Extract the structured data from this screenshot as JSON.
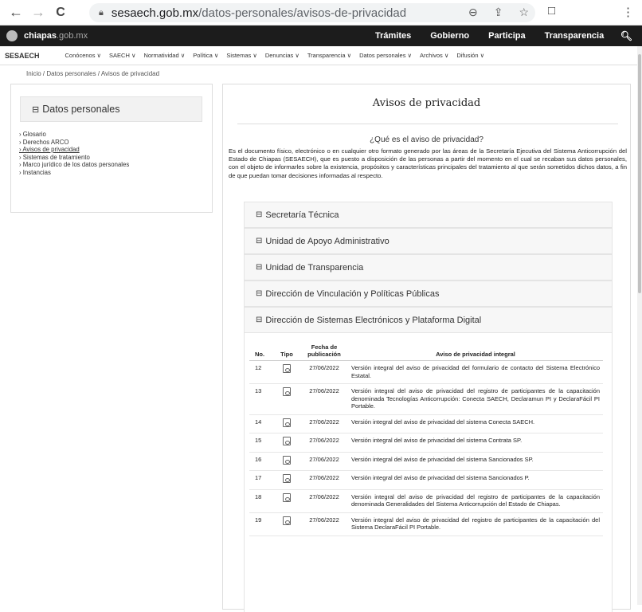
{
  "browser": {
    "back": "←",
    "forward": "→",
    "reload": "C",
    "url_host": "sesaech.gob.mx",
    "url_path": "/datos-personales/avisos-de-privacidad"
  },
  "topbar": {
    "logo_bold": "chiapas",
    "logo_rest": ".gob.mx",
    "links": [
      "Trámites",
      "Gobierno",
      "Participa",
      "Transparencia"
    ]
  },
  "subnav": {
    "brand": "SESAECH",
    "items": [
      "Conócenos ∨",
      "SAECH ∨",
      "Normatividad ∨",
      "Política ∨",
      "Sistemas ∨",
      "Denuncias ∨",
      "Transparencia ∨",
      "Datos personales ∨",
      "Archivos ∨",
      "Difusión ∨"
    ]
  },
  "breadcrumb": "Inicio / Datos personales / Avisos de privacidad",
  "side": {
    "title": "Datos personales",
    "items": [
      "› Glosario",
      "› Derechos ARCO",
      "› Avisos de privacidad",
      "› Sistemas de tratamiento",
      "› Marco jurídico de los datos personales",
      "› Instancias"
    ]
  },
  "main": {
    "title": "Avisos de privacidad",
    "question": "¿Qué es el aviso de privacidad?",
    "intro": "Es el documento físico, electrónico o en cualquier otro formato generado por las áreas de la Secretaría Ejecutiva del Sistema Anticorrupción del Estado de Chiapas (SESAECH), que es puesto a disposición de las personas a partir del momento en el cual se recaban sus datos personales, con el objeto de informarles sobre la existencia, propósitos y características principales del tratamiento al que serán sometidos dichos datos, a fin de que puedan tomar decisiones informadas al respecto.",
    "sections": [
      "Secretaría Técnica",
      "Unidad de Apoyo Administrativo",
      "Unidad de Transparencia",
      "Dirección de Vinculación y Políticas Públicas",
      "Dirección de Sistemas Electrónicos y Plataforma Digital"
    ],
    "table": {
      "headers": [
        "No.",
        "Tipo",
        "Fecha de publicación",
        "Aviso de privacidad integral"
      ],
      "rows": [
        {
          "no": "12",
          "fecha": "27/06/2022",
          "desc": "Versión integral del aviso de privacidad del formulario de contacto del Sistema Electrónico Estatal."
        },
        {
          "no": "13",
          "fecha": "27/06/2022",
          "desc": "Versión integral del aviso de privacidad del registro de participantes de la capacitación denominada Tecnologías Anticorrupción: Conecta SAECH, Declaramun PI y DeclaraFácil PI Portable."
        },
        {
          "no": "14",
          "fecha": "27/06/2022",
          "desc": "Versión integral del aviso de privacidad del sistema Conecta SAECH."
        },
        {
          "no": "15",
          "fecha": "27/06/2022",
          "desc": "Versión integral del aviso de privacidad del sistema Contrata SP."
        },
        {
          "no": "16",
          "fecha": "27/06/2022",
          "desc": "Versión integral del aviso de privacidad del sistema Sancionados SP."
        },
        {
          "no": "17",
          "fecha": "27/06/2022",
          "desc": "Versión integral del aviso de privacidad del sistema Sancionados P."
        },
        {
          "no": "18",
          "fecha": "27/06/2022",
          "desc": "Versión integral del aviso de privacidad del registro de participantes de la capacitación denominada Generalidades del Sistema Anticorrupción del Estado de Chiapas."
        },
        {
          "no": "19",
          "fecha": "27/06/2022",
          "desc": "Versión integral del aviso de privacidad del registro de participantes de la capacitación del Sistema DeclaraFácil PI Portable."
        }
      ]
    }
  }
}
